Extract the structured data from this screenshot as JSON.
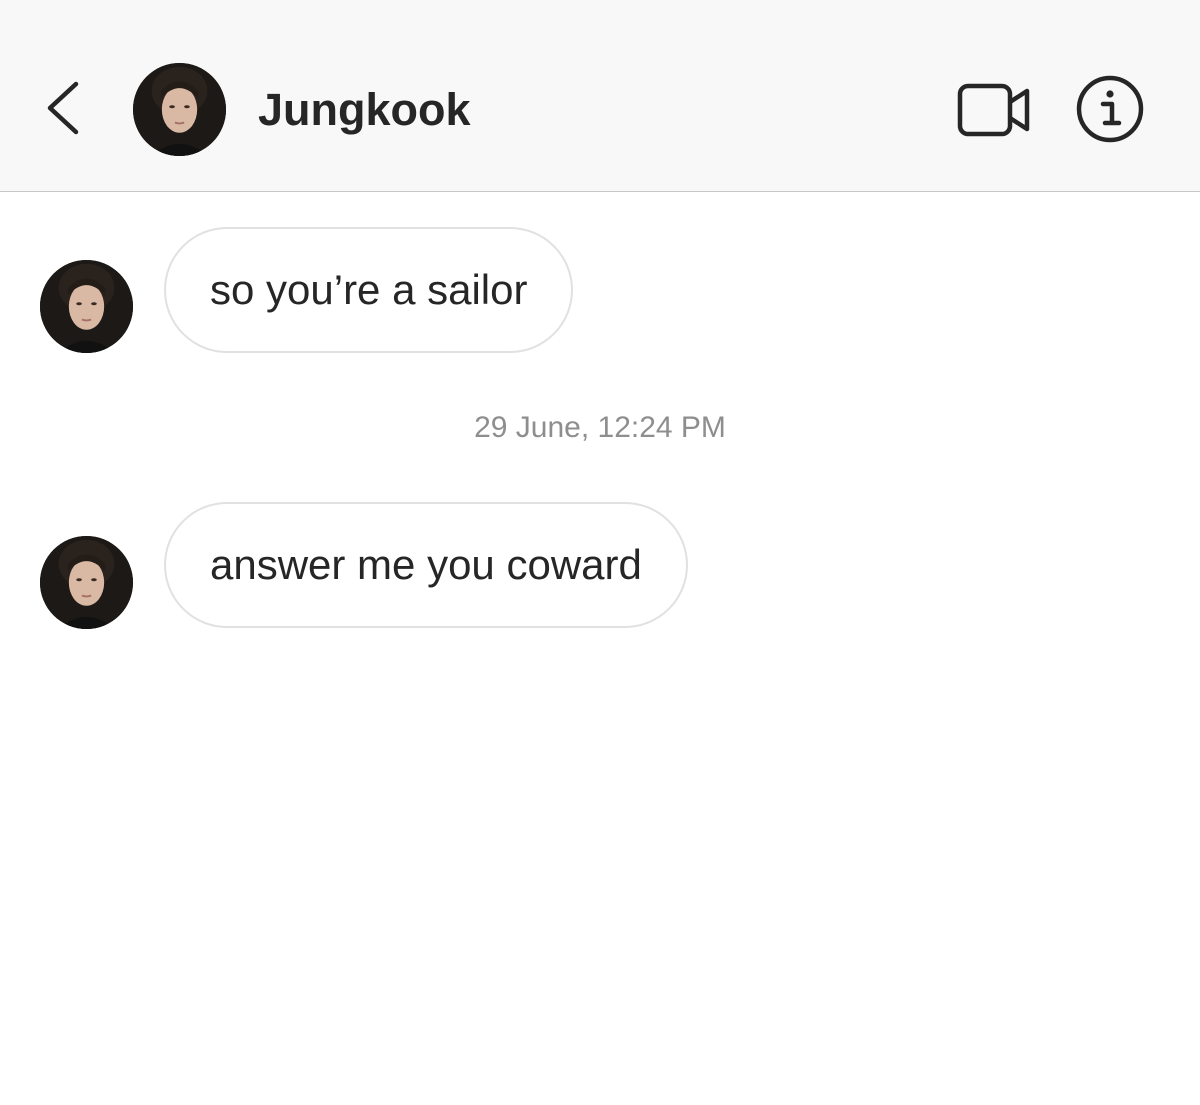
{
  "header": {
    "title": "Jungkook",
    "back_icon": "chevron-left-icon",
    "video_icon": "video-camera-icon",
    "info_icon": "info-circle-icon"
  },
  "messages": [
    {
      "sender": "Jungkook",
      "text": "so you’re a sailor"
    },
    {
      "sender": "Jungkook",
      "text": "answer me you coward"
    }
  ],
  "timestamp": "29 June, 12:24 PM",
  "colors": {
    "header_bg": "#f8f8f8",
    "text": "#262626",
    "timestamp": "#8e8e8e",
    "bubble_border": "#e1e1e1"
  }
}
